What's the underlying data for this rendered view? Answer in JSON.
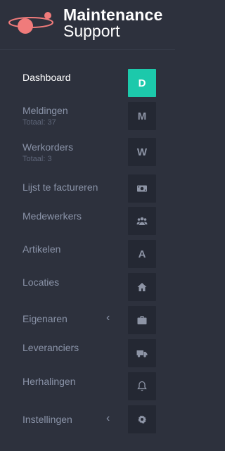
{
  "brand": {
    "line1": "Maintenance",
    "line2": "Support",
    "accent": "#f07b7b"
  },
  "colors": {
    "active": "#1cc9ab",
    "bg": "#2d313d",
    "tile": "#242833"
  },
  "nav": [
    {
      "label": "Dashboard",
      "icon_text": "D",
      "active": true
    },
    {
      "label": "Meldingen",
      "sub": "Totaal: 37",
      "icon_text": "M"
    },
    {
      "label": "Werkorders",
      "sub": "Totaal: 3",
      "icon_text": "W"
    },
    {
      "label": "Lijst te factureren",
      "icon": "money-icon"
    },
    {
      "label": "Medewerkers",
      "icon": "users-icon"
    },
    {
      "label": "Artikelen",
      "icon_text": "A"
    },
    {
      "label": "Locaties",
      "icon": "home-icon"
    },
    {
      "label": "Eigenaren",
      "icon": "briefcase-icon",
      "chevron": "‹"
    },
    {
      "label": "Leveranciers",
      "icon": "truck-icon"
    },
    {
      "label": "Herhalingen",
      "icon": "bell-icon"
    },
    {
      "label": "Instellingen",
      "icon": "gear-icon",
      "chevron": "‹"
    }
  ]
}
